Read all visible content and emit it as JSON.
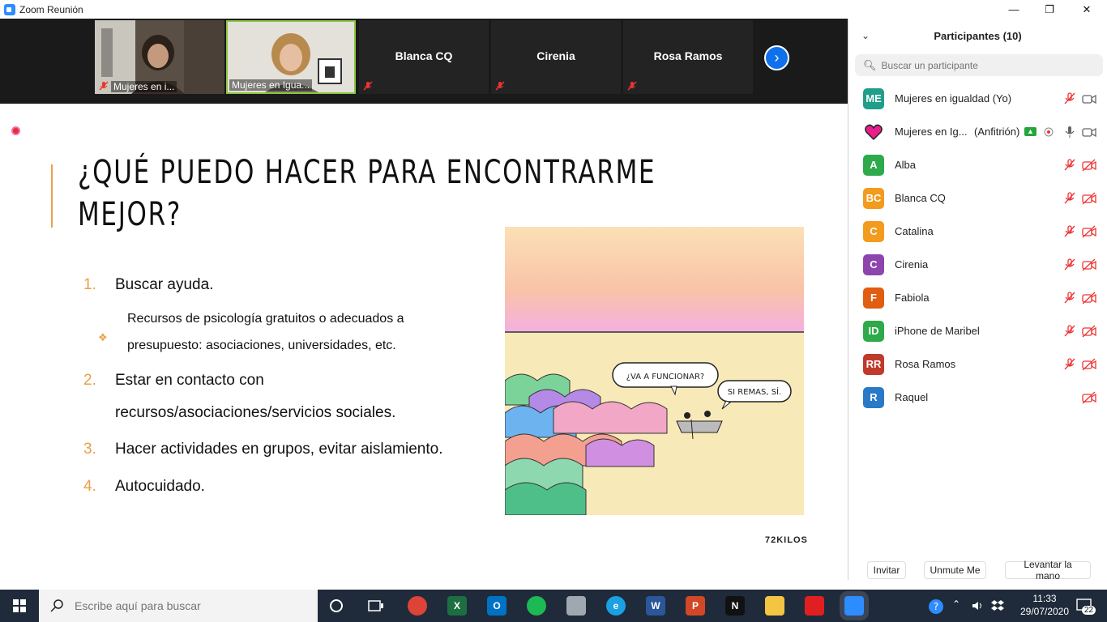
{
  "window": {
    "title": "Zoom Reunión",
    "minimize": "—",
    "maximize": "❐",
    "close": "✕"
  },
  "strip": {
    "tiles": [
      {
        "caption": "Mujeres en i..."
      },
      {
        "caption": "Mujeres en Igua..."
      },
      {
        "name": "Blanca CQ"
      },
      {
        "name": "Cirenia"
      },
      {
        "name": "Rosa Ramos"
      }
    ],
    "next_glyph": "›"
  },
  "slide": {
    "title_line1": "¿QUÉ PUEDO HACER PARA ENCONTRARME",
    "title_line2": "MEJOR?",
    "items": [
      {
        "num": "1.",
        "text": "Buscar ayuda."
      },
      {
        "num": "2.",
        "text_line1": "Estar en contacto con",
        "text_line2": "recursos/asociaciones/servicios sociales."
      },
      {
        "num": "3.",
        "text": "Hacer actividades en grupos, evitar aislamiento."
      },
      {
        "num": "4.",
        "text": "Autocuidado."
      }
    ],
    "subitem": {
      "bullet": "❖",
      "line1": "Recursos de psicología gratuitos o adecuados a",
      "line2": "presupuesto: asociaciones, universidades, etc."
    },
    "cartoon": {
      "bubble1": "¿VA A FUNCIONAR?",
      "bubble2": "SI REMAS, SÍ.",
      "signature": "72KILOS"
    },
    "accent": "#e8a048"
  },
  "panel": {
    "title": "Participantes (10)",
    "collapse": "⌄",
    "search_placeholder": "Buscar un participante",
    "participants": [
      {
        "initials": "ME",
        "name": "Mujeres en igualdad (Yo)",
        "color": "#1f9e89",
        "mic": "muted",
        "video": "on"
      },
      {
        "initials": "",
        "name": "Mujeres en Ig...",
        "role": "(Anfitrión)",
        "color": "#ffffff",
        "mic": "on",
        "video": "on"
      },
      {
        "initials": "A",
        "name": "Alba",
        "color": "#2eaa4a",
        "mic": "muted",
        "video": "off"
      },
      {
        "initials": "BC",
        "name": "Blanca CQ",
        "color": "#f29b1d",
        "mic": "muted",
        "video": "off"
      },
      {
        "initials": "C",
        "name": "Catalina",
        "color": "#f29b1d",
        "mic": "muted",
        "video": "off"
      },
      {
        "initials": "C",
        "name": "Cirenia",
        "color": "#8e44ad",
        "mic": "muted",
        "video": "off"
      },
      {
        "initials": "F",
        "name": "Fabiola",
        "color": "#e05d11",
        "mic": "muted",
        "video": "off"
      },
      {
        "initials": "ID",
        "name": "iPhone de Maribel",
        "color": "#2eaa4a",
        "mic": "muted",
        "video": "off"
      },
      {
        "initials": "RR",
        "name": "Rosa Ramos",
        "color": "#c0392b",
        "mic": "muted",
        "video": "off"
      },
      {
        "initials": "R",
        "name": "Raquel",
        "color": "#2979c6",
        "mic": "none",
        "video": "off"
      }
    ],
    "footer": {
      "invite": "Invitar",
      "unmute": "Unmute Me",
      "raise": "Levantar la mano"
    }
  },
  "taskbar": {
    "search_placeholder": "Escribe aquí para buscar",
    "time": "11:33",
    "date": "29/07/2020",
    "notifications": "22",
    "apps": [
      {
        "name": "chrome",
        "color": "#db4437"
      },
      {
        "name": "excel",
        "color": "#1d6f42",
        "label": "X"
      },
      {
        "name": "outlook",
        "color": "#0072c6",
        "label": "O"
      },
      {
        "name": "spotify",
        "color": "#1db954"
      },
      {
        "name": "paint",
        "color": "#9fa8b0"
      },
      {
        "name": "ie",
        "color": "#1ba1e2",
        "label": "e"
      },
      {
        "name": "word",
        "color": "#2b579a",
        "label": "W"
      },
      {
        "name": "powerpoint",
        "color": "#d24726",
        "label": "P"
      },
      {
        "name": "netflix",
        "color": "#111111",
        "label": "N"
      },
      {
        "name": "explorer",
        "color": "#f4c542"
      },
      {
        "name": "acrobat",
        "color": "#e02020"
      },
      {
        "name": "zoom",
        "color": "#2D8CFF"
      }
    ]
  }
}
